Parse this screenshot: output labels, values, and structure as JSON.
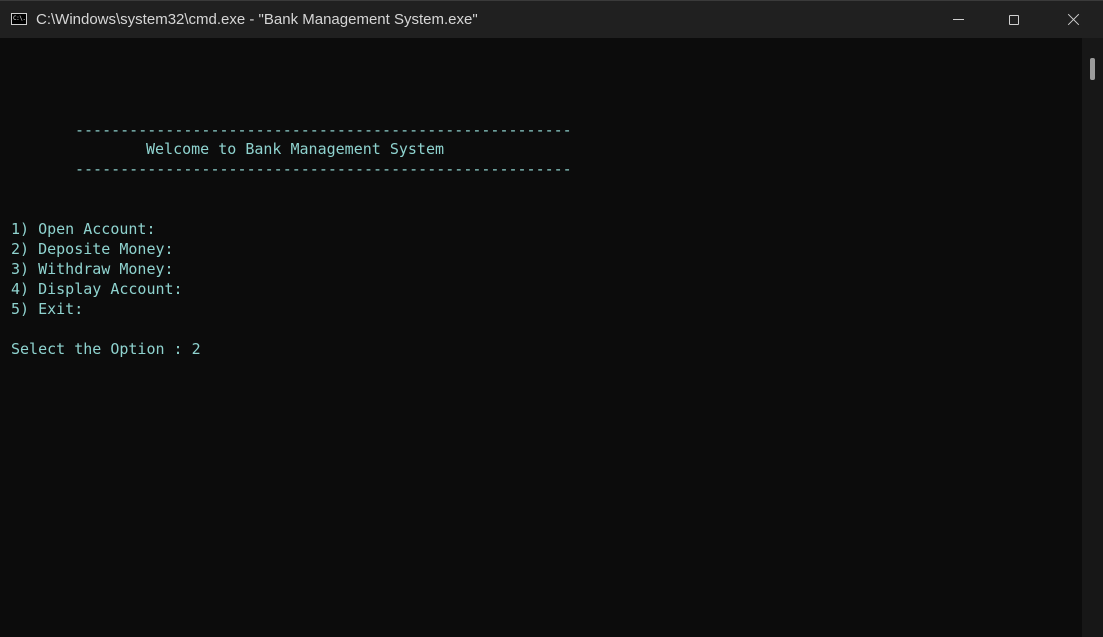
{
  "window": {
    "title": "C:\\Windows\\system32\\cmd.exe - \"Bank Management System.exe\"",
    "app_icon": "cmd-icon",
    "app_icon_glyph": "C:\\.",
    "controls": {
      "minimize": "minimize-icon",
      "maximize": "maximize-icon",
      "close": "close-icon"
    }
  },
  "console": {
    "text_color": "#8fd3cf",
    "background": "#0c0c0c",
    "divider_top": "-------------------------------------------------------",
    "welcome": "Welcome to Bank Management System",
    "divider_bottom": "-------------------------------------------------------",
    "menu": [
      "1) Open Account:",
      "2) Deposite Money:",
      "3) Withdraw Money:",
      "4) Display Account:",
      "5) Exit:"
    ],
    "prompt": "Select the Option : 2"
  }
}
